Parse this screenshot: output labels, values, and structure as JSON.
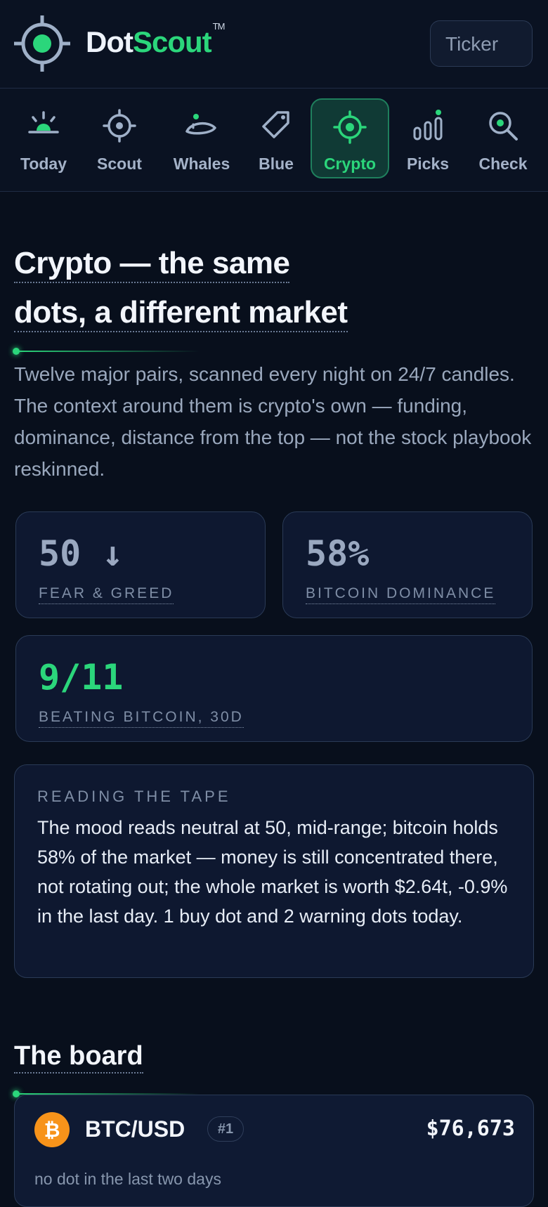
{
  "brand": {
    "part1": "Dot",
    "part2": "Scout",
    "tm": "TM",
    "logo_icon": "target-crosshair-icon"
  },
  "search": {
    "placeholder": "Ticker"
  },
  "nav": {
    "items": [
      {
        "label": "Today",
        "icon": "sunrise-icon"
      },
      {
        "label": "Scout",
        "icon": "crosshair-icon"
      },
      {
        "label": "Whales",
        "icon": "whale-icon"
      },
      {
        "label": "Blue",
        "icon": "tag-icon"
      },
      {
        "label": "Crypto",
        "icon": "crosshair-icon",
        "active": true
      },
      {
        "label": "Picks",
        "icon": "bar-chart-icon"
      },
      {
        "label": "Check",
        "icon": "magnifier-icon"
      }
    ]
  },
  "page": {
    "title_line1": "Crypto — the same",
    "title_line2": "dots, a different market",
    "intro": "Twelve major pairs, scanned every night on 24/7 candles. The context around them is crypto's own — funding, dominance, distance from the top — not the stock playbook reskinned."
  },
  "stats": {
    "fear_greed": {
      "value": "50 ↓",
      "label": "FEAR & GREED"
    },
    "dominance": {
      "value": "58%",
      "label": "BITCOIN DOMINANCE"
    },
    "beating": {
      "value": "9/11",
      "label": "BEATING BITCOIN, 30D"
    }
  },
  "tape": {
    "title": "READING THE TAPE",
    "body": "The mood reads neutral at 50, mid-range; bitcoin holds 58% of the market — money is still concentrated there, not rotating out; the whole market is worth $2.64t, -0.9% in the last day. 1 buy dot and 2 warning dots today."
  },
  "board": {
    "title": "The board",
    "rows": [
      {
        "pair": "BTC/USD",
        "rank": "#1",
        "price": "$76,673",
        "note": "no dot in the last two days",
        "icon": "bitcoin-icon"
      }
    ]
  },
  "colors": {
    "accent": "#2bd67b",
    "background": "#080f1c",
    "bitcoin": "#f7931a"
  }
}
